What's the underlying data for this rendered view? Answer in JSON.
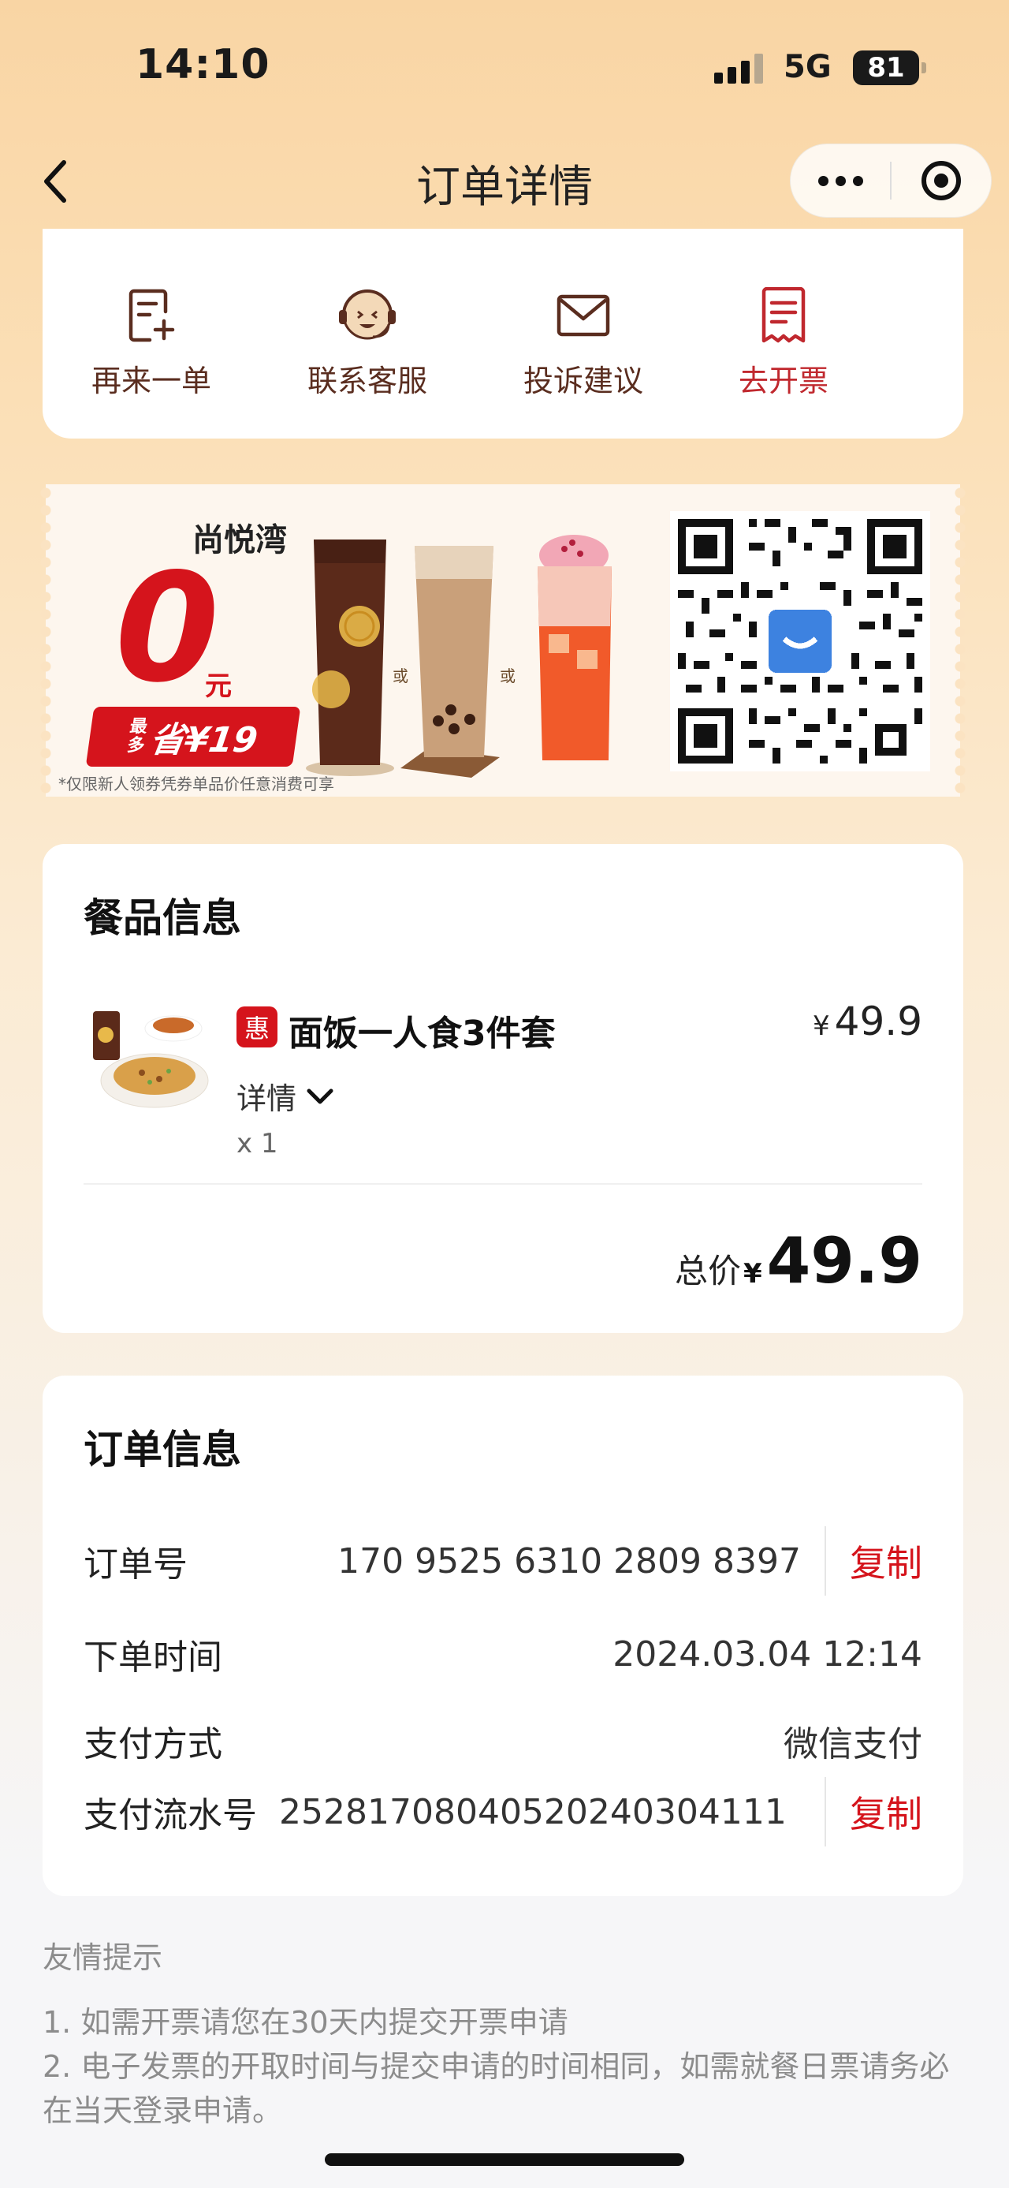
{
  "status_bar": {
    "time": "14:10",
    "network": "5G",
    "battery": "81"
  },
  "nav": {
    "title": "订单详情",
    "back_icon": "chevron-left-icon",
    "more_icon": "ellipsis-icon",
    "close_icon": "target-circle-icon"
  },
  "actions": [
    {
      "label": "再来一单",
      "icon": "reorder-icon"
    },
    {
      "label": "联系客服",
      "icon": "customer-service-icon"
    },
    {
      "label": "投诉建议",
      "icon": "envelope-icon"
    },
    {
      "label": "去开票",
      "icon": "receipt-icon"
    }
  ],
  "promo": {
    "store": "尚悦湾",
    "big_number": "0",
    "unit": "元",
    "save_text": "最多省¥19",
    "save_prefix_top": "最",
    "save_prefix_bottom": "多",
    "save_main": "省¥19",
    "note": "*仅限新人领券凭券单品价任意消费可享",
    "or_label": "或"
  },
  "meal": {
    "section_title": "餐品信息",
    "tag": "惠",
    "name": "面饭一人食3件套",
    "currency": "¥",
    "price": "49.9",
    "detail_label": "详情",
    "quantity": "x 1",
    "total_label": "总价",
    "total_price": "49.9"
  },
  "order": {
    "section_title": "订单信息",
    "rows": [
      {
        "label": "订单号",
        "value": "170 9525 6310 2809 8397",
        "action": "复制"
      },
      {
        "label": "下单时间",
        "value": "2024.03.04 12:14"
      },
      {
        "label": "支付方式",
        "value": "微信支付"
      },
      {
        "label": "支付流水号",
        "value": "25281708040520240304111",
        "action": "复制"
      }
    ]
  },
  "tips": {
    "title": "友情提示",
    "lines": [
      "1. 如需开票请您在30天内提交开票申请",
      "2. 电子发票的开取时间与提交申请的时间相同，如需就餐日票请务必在当天登录申请。"
    ]
  },
  "colors": {
    "accent_red": "#d5141c",
    "action_brown": "#5a2d1f",
    "page_top": "#f9d5a4"
  }
}
